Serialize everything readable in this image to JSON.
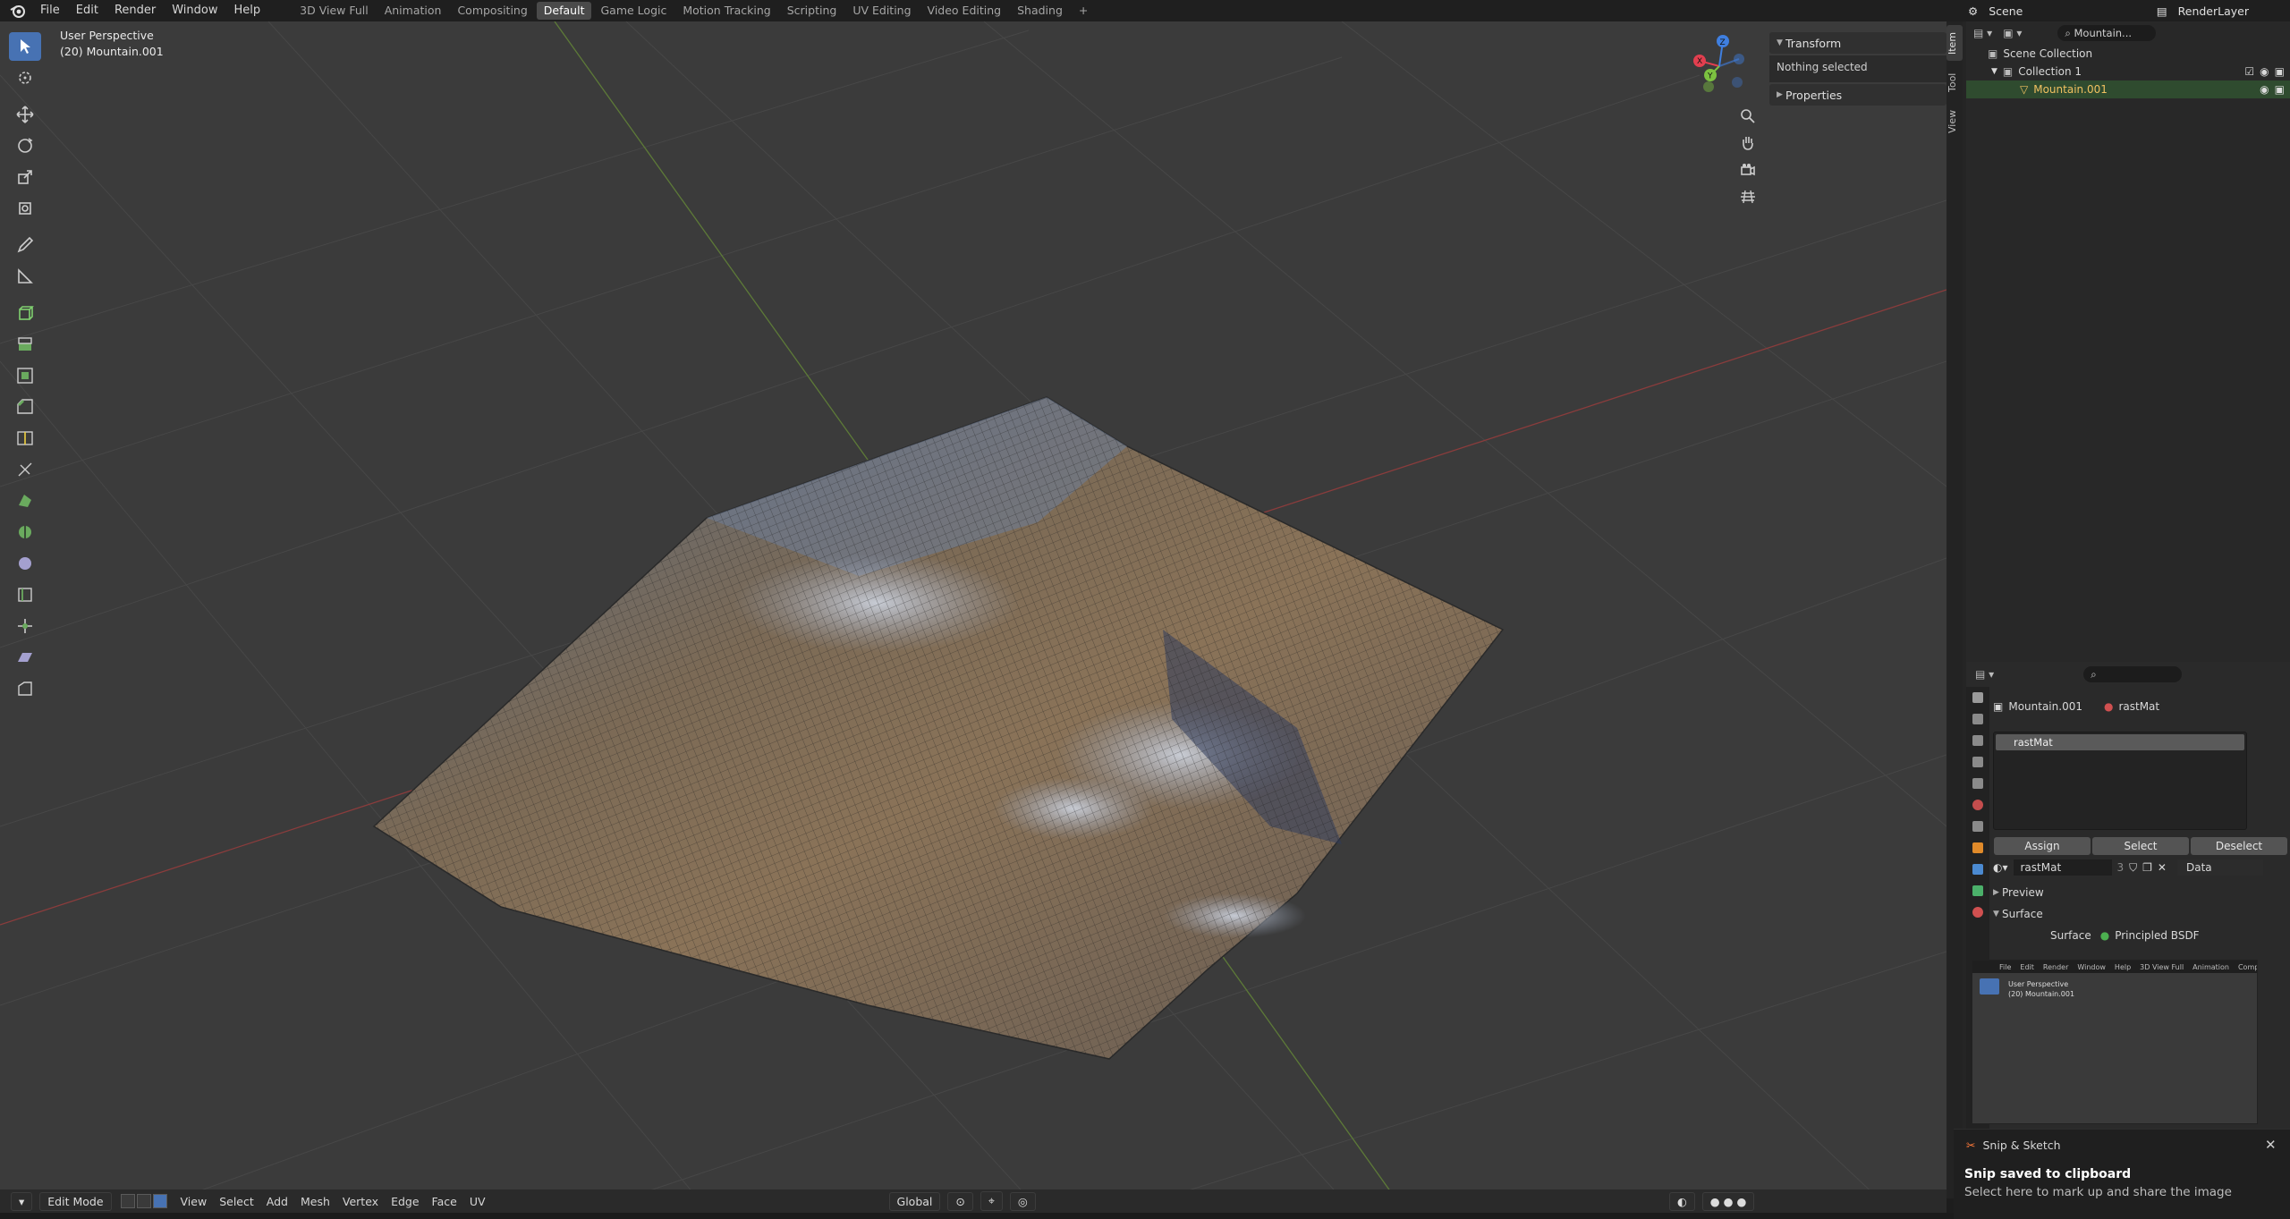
{
  "menu": {
    "items": [
      "File",
      "Edit",
      "Render",
      "Window",
      "Help"
    ],
    "workspaces": [
      "3D View Full",
      "Animation",
      "Compositing",
      "Default",
      "Game Logic",
      "Motion Tracking",
      "Scripting",
      "UV Editing",
      "Video Editing",
      "Shading"
    ],
    "active_workspace": "Default",
    "add_tab": "+"
  },
  "scene_header": {
    "scene_name": "Scene",
    "render_layer": "RenderLayer"
  },
  "viewport": {
    "perspective": "User Perspective",
    "object_label": "(20) Mountain.001",
    "gizmo_axes": [
      "X",
      "Y",
      "Z"
    ],
    "axis_colors": {
      "x": "#e23f4f",
      "y": "#7cc240",
      "z": "#3f7fe0"
    }
  },
  "npanel": {
    "tabs": [
      "Item",
      "Tool",
      "View"
    ],
    "active_tab": "Item",
    "transform_title": "Transform",
    "transform_status": "Nothing selected",
    "properties_title": "Properties"
  },
  "footer": {
    "mode": "Edit Mode",
    "menus": [
      "View",
      "Select",
      "Add",
      "Mesh",
      "Vertex",
      "Edge",
      "Face",
      "UV"
    ],
    "orientation": "Global"
  },
  "outliner": {
    "search": "Mountain...",
    "root": "Scene Collection",
    "collection": "Collection 1",
    "object": "Mountain.001"
  },
  "properties": {
    "object_name": "Mountain.001",
    "material_name": "rastMat",
    "slot_item": "rastMat",
    "buttons": [
      "Assign",
      "Select",
      "Deselect"
    ],
    "material_field": "rastMat",
    "user_count": "3",
    "link_mode": "Data",
    "preview_title": "Preview",
    "surface_title": "Surface",
    "surface_label": "Surface",
    "surface_shader": "Principled BSDF",
    "shader_color": "#4caf50"
  },
  "thumbnail": {
    "menus": [
      "File",
      "Edit",
      "Render",
      "Window",
      "Help",
      "3D View Full",
      "Animation",
      "Compos"
    ],
    "perspective": "User Perspective",
    "object_label": "(20) Mountain.001"
  },
  "toast": {
    "app": "Snip & Sketch",
    "title": "Snip saved to clipboard",
    "body": "Select here to mark up and share the image",
    "close": "✕"
  }
}
